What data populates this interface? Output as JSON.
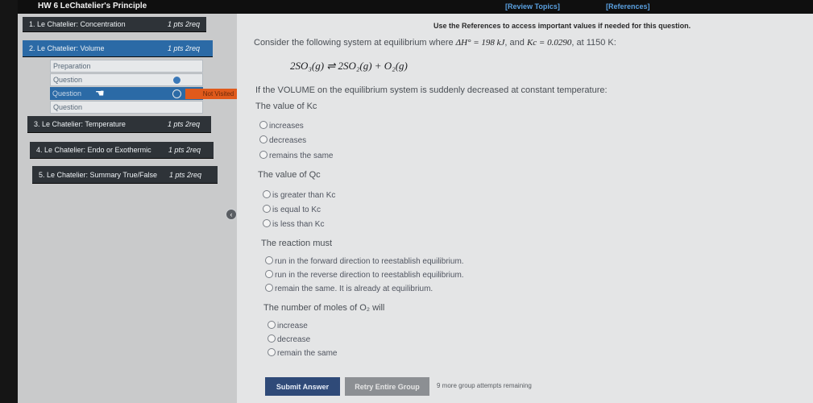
{
  "header": {
    "title": "HW 6 LeChatelier's Principle",
    "review_topics": "[Review Topics]",
    "references": "[References]"
  },
  "sidebar": {
    "items": [
      {
        "label": "1. Le Chatelier: Concentration",
        "pts": "1 pts  2req"
      },
      {
        "label": "2. Le Chatelier: Volume",
        "pts": "1 pts  2req"
      },
      {
        "label": "3. Le Chatelier: Temperature",
        "pts": "1 pts  2req"
      },
      {
        "label": "4. Le Chatelier: Endo or Exothermic",
        "pts": "1 pts  2req"
      },
      {
        "label": "5. Le Chatelier: Summary True/False",
        "pts": "1 pts  2req"
      }
    ],
    "subitems": [
      "Preparation",
      "Question",
      "Question",
      "Question"
    ],
    "not_visited": "Not Visited"
  },
  "main": {
    "use_references": "Use the References to access important values if needed for this question.",
    "intro_a": "Consider the following system at equilibrium where ",
    "delta_h": "ΔH° = 198 kJ",
    "intro_b": ", and ",
    "kc_value": "Kc = 0.0290",
    "intro_c": ", at 1150 K:",
    "equation": "2SO₃(g) ⇌ 2SO₂(g) + O₂(g)",
    "volume_statement": "If the VOLUME on the equilibrium system is suddenly decreased at constant temperature:",
    "q1": {
      "prompt": "The value of Kc",
      "options": [
        "increases",
        "decreases",
        "remains the same"
      ]
    },
    "q2": {
      "prompt": "The value of Qc",
      "options": [
        "is greater than Kc",
        "is equal to Kc",
        "is less than Kc"
      ]
    },
    "q3": {
      "prompt": "The reaction must",
      "options": [
        "run in the forward direction to reestablish equilibrium.",
        "run in the reverse direction to reestablish equilibrium.",
        "remain the same. It is already at equilibrium."
      ]
    },
    "q4": {
      "prompt": "The number of moles of O₂ will",
      "options": [
        "increase",
        "decrease",
        "remain the same"
      ]
    }
  },
  "footer": {
    "submit": "Submit Answer",
    "retry": "Retry Entire Group",
    "attempts": "9 more group attempts remaining"
  },
  "colors": {
    "accent": "#2b6aa6",
    "submit": "#2f4a78",
    "not_visited": "#e05a1c"
  }
}
